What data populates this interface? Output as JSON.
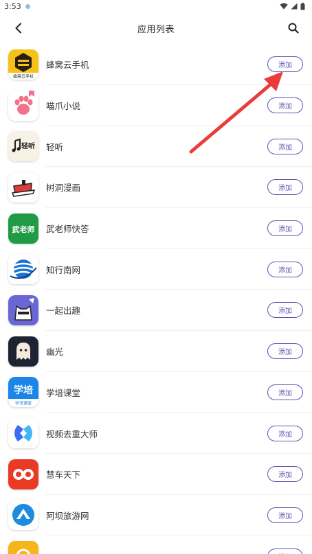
{
  "status": {
    "time": "3:53"
  },
  "header": {
    "title": "应用列表",
    "back_icon": "back-arrow-icon",
    "search_icon": "search-icon"
  },
  "add_label": "添加",
  "apps": [
    {
      "name": "蜂窝云手机",
      "icon": "bee-icon"
    },
    {
      "name": "喵爪小说",
      "icon": "paw-icon"
    },
    {
      "name": "轻听",
      "icon": "music-note-icon"
    },
    {
      "name": "树洞漫画",
      "icon": "hat-icon"
    },
    {
      "name": "武老师快答",
      "icon": "wulaoshi-icon"
    },
    {
      "name": "知行南网",
      "icon": "globe-icon"
    },
    {
      "name": "一起出趣",
      "icon": "cat-icon"
    },
    {
      "name": "幽光",
      "icon": "ghost-icon"
    },
    {
      "name": "学培课堂",
      "icon": "xuepei-icon"
    },
    {
      "name": "视频去重大师",
      "icon": "video-dedup-icon"
    },
    {
      "name": "慧车天下",
      "icon": "infinity-icon"
    },
    {
      "name": "阿坝旅游网",
      "icon": "aba-icon"
    },
    {
      "name": "",
      "icon": "partial-icon"
    }
  ],
  "icon_text": {
    "bee": "蜂窝云手机",
    "ting": "轻听",
    "wulaoshi": "武老师",
    "xuepei_big": "学培",
    "xuepei_small": "学培课堂"
  },
  "colors": {
    "accent": "#5a55b5",
    "arrow": "#ec3b3b"
  }
}
